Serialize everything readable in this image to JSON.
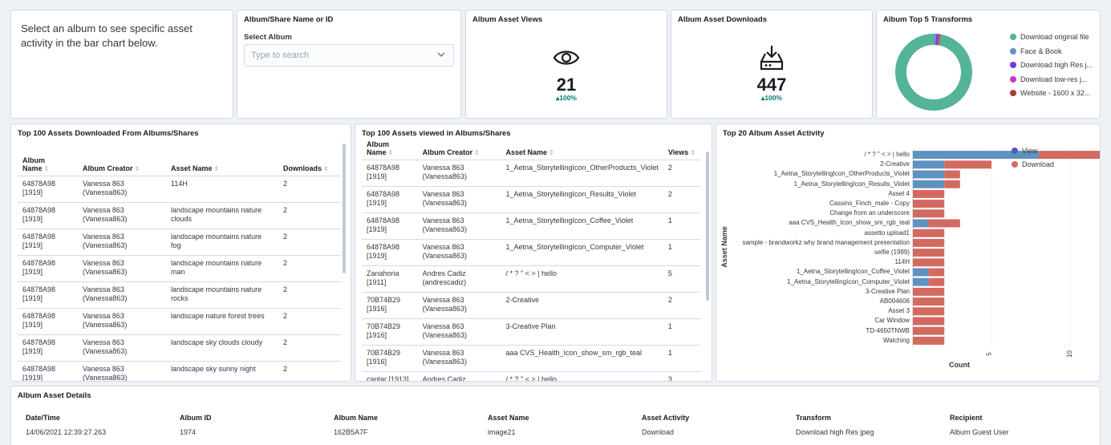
{
  "intro": {
    "text": "Select an album to see specific asset activity in the bar chart below."
  },
  "album_filter": {
    "title": "Album/Share Name or ID",
    "label": "Select Album",
    "placeholder": "Type to search"
  },
  "views_metric": {
    "title": "Album Asset Views",
    "value": "21",
    "change": "▴100%",
    "icon": "eye-icon"
  },
  "downloads_metric": {
    "title": "Album Asset Downloads",
    "value": "447",
    "change": "▴100%",
    "icon": "download-drive-icon"
  },
  "transforms": {
    "title": "Album Top 5 Transforms",
    "items": [
      {
        "label": "Download original file",
        "color": "#54b399"
      },
      {
        "label": "Face & Book",
        "color": "#6092c0"
      },
      {
        "label": "Download high Res j...",
        "color": "#6742d6"
      },
      {
        "label": "Download low-res j...",
        "color": "#ca37c3"
      },
      {
        "label": "Website - 1600 x 32...",
        "color": "#aa3939"
      }
    ]
  },
  "downloads_table": {
    "title": "Top 100 Assets Downloaded From Albums/Shares",
    "headers": [
      "Album Name",
      "Album Creator",
      "Asset Name",
      "Downloads"
    ],
    "rows": [
      [
        "64878A98 [1919]",
        "Vanessa 863 (Vanessa863)",
        "114H",
        "2"
      ],
      [
        "64878A98 [1919]",
        "Vanessa 863 (Vanessa863)",
        "landscape mountains nature clouds",
        "2"
      ],
      [
        "64878A98 [1919]",
        "Vanessa 863 (Vanessa863)",
        "landscape mountains nature fog",
        "2"
      ],
      [
        "64878A98 [1919]",
        "Vanessa 863 (Vanessa863)",
        "landscape mountains nature man",
        "2"
      ],
      [
        "64878A98 [1919]",
        "Vanessa 863 (Vanessa863)",
        "landscape mountains nature rocks",
        "2"
      ],
      [
        "64878A98 [1919]",
        "Vanessa 863 (Vanessa863)",
        "landscape nature forest trees",
        "2"
      ],
      [
        "64878A98 [1919]",
        "Vanessa 863 (Vanessa863)",
        "landscape sky clouds cloudy",
        "2"
      ],
      [
        "64878A98 [1919]",
        "Vanessa 863 (Vanessa863)",
        "landscape sky sunny night",
        "2"
      ]
    ]
  },
  "views_table": {
    "title": "Top 100 Assets viewed in Albums/Shares",
    "headers": [
      "Album Name",
      "Album Creator",
      "Asset Name",
      "Views"
    ],
    "rows": [
      [
        "64878A98 [1919]",
        "Vanessa 863 (Vanessa863)",
        "1_Aetna_StorytellingIcon_OtherProducts_Violet",
        "2"
      ],
      [
        "64878A98 [1919]",
        "Vanessa 863 (Vanessa863)",
        "1_Aetna_StorytellingIcon_Results_Violet",
        "2"
      ],
      [
        "64878A98 [1919]",
        "Vanessa 863 (Vanessa863)",
        "1_Aetna_StorytellingIcon_Coffee_Violet",
        "1"
      ],
      [
        "64878A98 [1919]",
        "Vanessa 863 (Vanessa863)",
        "1_Aetna_StorytellingIcon_Computer_Violet",
        "1"
      ],
      [
        "Zanahoria [1911]",
        "Andres Cadiz (andrescadiz)",
        "/ * ? \" < > | hello",
        "5"
      ],
      [
        "70B74B29 [1916]",
        "Vanessa 863 (Vanessa863)",
        "2-Creative",
        "2"
      ],
      [
        "70B74B29 [1916]",
        "Vanessa 863 (Vanessa863)",
        "3-Creative Plan",
        "1"
      ],
      [
        "70B74B29 [1916]",
        "Vanessa 863 (Vanessa863)",
        "aaa CVS_Health_Icon_show_sm_rgb_teal",
        "1"
      ],
      [
        "cantar [1913]",
        "Andres Cadiz",
        "/ * ? \" < > | hello",
        "3"
      ]
    ]
  },
  "activity_chart": {
    "title": "Top 20 Album Asset Activity",
    "ylabel": "Asset Name",
    "xlabel": "Count",
    "x_ticks": [
      "5",
      "10"
    ],
    "colors": {
      "view": "#6092c0",
      "download": "#d36086"
    }
  },
  "chart_data": {
    "type": "bar",
    "orientation": "horizontal",
    "stacked": true,
    "title": "Top 20 Album Asset Activity",
    "xlabel": "Count",
    "ylabel": "Asset Name",
    "xlim": [
      0,
      12
    ],
    "legend_position": "top-right",
    "categories": [
      "/ * ? \" < > | hello",
      "2-Creative",
      "1_Aetna_StorytellingIcon_OtherProducts_Violet",
      "1_Aetna_StorytellingIcon_Results_Violet",
      "Asset 4",
      "Cassins_Finch_male - Copy",
      "Change from an underscore",
      "aaa CVS_Health_Icon_show_sm_rgb_teal",
      "assetto upload1",
      "sample - brandworkz why brand management presentation",
      "selfie (1999)",
      "114H",
      "1_Aetna_StorytellingIcon_Coffee_Violet",
      "1_Aetna_StorytellingIcon_Computer_Violet",
      "3-Creative Plan",
      "AB004606",
      "Asset 3",
      "Car Window",
      "TD-4650TNWB",
      "Watching"
    ],
    "series": [
      {
        "name": "View",
        "color": "#6092c0",
        "values": [
          8,
          2,
          2,
          2,
          0,
          0,
          0,
          1,
          0,
          0,
          0,
          0,
          1,
          1,
          0,
          0,
          0,
          0,
          0,
          0
        ]
      },
      {
        "name": "Download",
        "color": "#d36086",
        "values": [
          4,
          3,
          1,
          1,
          2,
          2,
          2,
          2,
          2,
          2,
          2,
          2,
          1,
          1,
          2,
          2,
          2,
          2,
          2,
          2
        ]
      }
    ]
  },
  "details_table": {
    "title": "Album Asset Details",
    "headers": [
      "Date/Time",
      "Album ID",
      "Album Name",
      "Asset Name",
      "Asset Activity",
      "Transform",
      "Recipient"
    ],
    "rows": [
      [
        "14/06/2021 12:39:27.263",
        "1974",
        "162B5A7F",
        "image21",
        "Download",
        "Download high Res jpeg",
        "Album Guest User"
      ]
    ]
  }
}
